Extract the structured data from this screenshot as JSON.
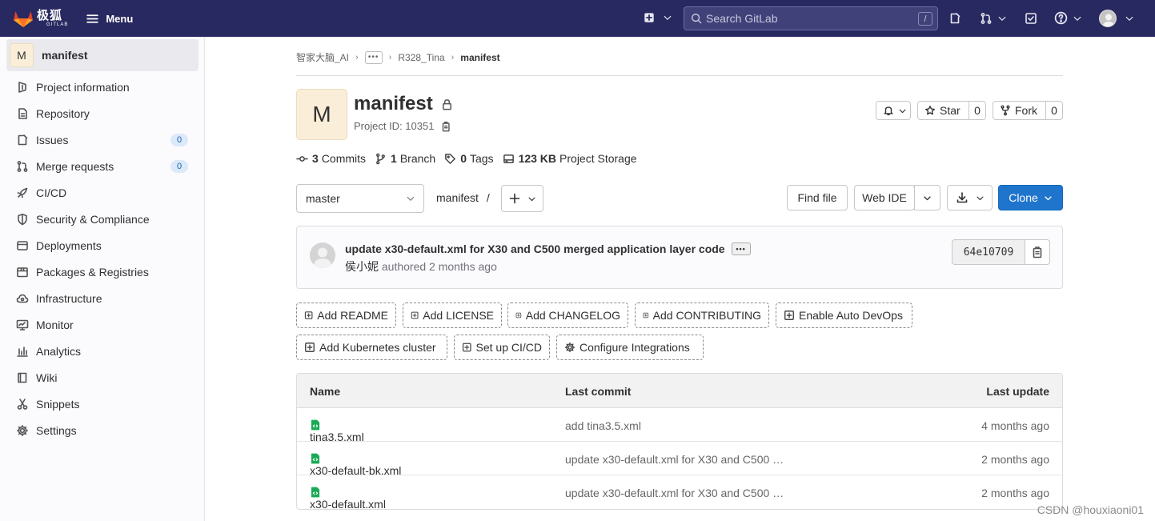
{
  "topbar": {
    "logo_text": "极狐",
    "logo_sub": "GITLAB",
    "menu_label": "Menu",
    "search_placeholder": "Search GitLab",
    "search_shortcut": "/",
    "colors": {
      "bar": "#292961",
      "search": "#41417a"
    },
    "icons": [
      "plus-square-icon",
      "issues-icon",
      "merge-request-icon",
      "todo-icon",
      "help-icon",
      "avatar"
    ]
  },
  "sidebar": {
    "project_avatar": "M",
    "project_name": "manifest",
    "items": [
      {
        "label": "Project information",
        "icon": "project-icon"
      },
      {
        "label": "Repository",
        "icon": "doc-icon"
      },
      {
        "label": "Issues",
        "icon": "issues-icon",
        "badge": "0"
      },
      {
        "label": "Merge requests",
        "icon": "merge-request-icon",
        "badge": "0"
      },
      {
        "label": "CI/CD",
        "icon": "rocket-icon"
      },
      {
        "label": "Security & Compliance",
        "icon": "shield-icon"
      },
      {
        "label": "Deployments",
        "icon": "deployments-icon"
      },
      {
        "label": "Packages & Registries",
        "icon": "package-icon"
      },
      {
        "label": "Infrastructure",
        "icon": "cloud-icon"
      },
      {
        "label": "Monitor",
        "icon": "monitor-icon"
      },
      {
        "label": "Analytics",
        "icon": "analytics-icon"
      },
      {
        "label": "Wiki",
        "icon": "book-icon"
      },
      {
        "label": "Snippets",
        "icon": "snippet-icon"
      },
      {
        "label": "Settings",
        "icon": "gear-icon"
      }
    ]
  },
  "breadcrumb": {
    "group": "智家大脑_AI",
    "more": "•••",
    "subgroup": "R328_Tina",
    "current": "manifest"
  },
  "project": {
    "avatar": "M",
    "name": "manifest",
    "id_label": "Project ID: 10351",
    "star_label": "Star",
    "star_count": "0",
    "fork_label": "Fork",
    "fork_count": "0"
  },
  "stats": {
    "commits_count": "3",
    "commits_label": "Commits",
    "branches_count": "1",
    "branches_label": "Branch",
    "tags_count": "0",
    "tags_label": "Tags",
    "storage_size": "123 KB",
    "storage_label": "Project Storage"
  },
  "toolbar": {
    "branch": "master",
    "path": "manifest",
    "path_sep": "/",
    "find_file": "Find file",
    "web_ide": "Web IDE",
    "clone": "Clone",
    "clone_color": "#1f75cb"
  },
  "commit": {
    "title": "update x30-default.xml for X30 and C500 merged application layer code",
    "more": "•••",
    "author": "侯小妮",
    "authored": "authored 2 months ago",
    "sha": "64e10709"
  },
  "quick_actions": [
    "Add README",
    "Add LICENSE",
    "Add CHANGELOG",
    "Add CONTRIBUTING",
    "Enable Auto DevOps",
    "Add Kubernetes cluster",
    "Set up CI/CD",
    "Configure Integrations"
  ],
  "files": {
    "headers": {
      "name": "Name",
      "last_commit": "Last commit",
      "last_update": "Last update"
    },
    "rows": [
      {
        "name": "tina3.5.xml",
        "commit": "add tina3.5.xml",
        "updated": "4 months ago"
      },
      {
        "name": "x30-default-bk.xml",
        "commit": "update x30-default.xml for X30 and C500 …",
        "updated": "2 months ago"
      },
      {
        "name": "x30-default.xml",
        "commit": "update x30-default.xml for X30 and C500 …",
        "updated": "2 months ago"
      }
    ]
  },
  "watermark": "CSDN @houxiaoni01"
}
